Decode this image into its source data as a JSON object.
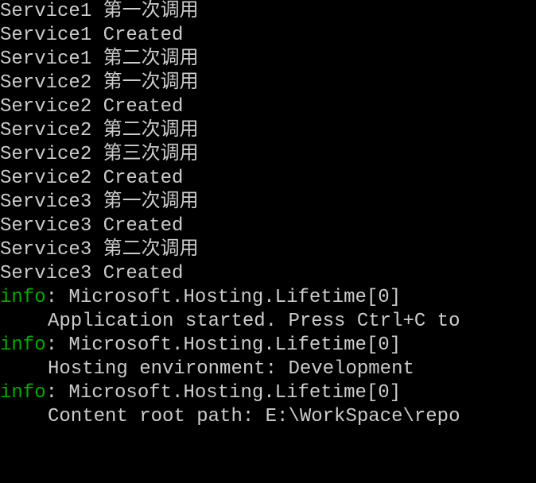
{
  "lines": [
    {
      "text": "Service1 第一次调用"
    },
    {
      "text": "Service1 Created"
    },
    {
      "text": "Service1 第二次调用"
    },
    {
      "text": "Service2 第一次调用"
    },
    {
      "text": "Service2 Created"
    },
    {
      "text": "Service2 第二次调用"
    },
    {
      "text": "Service2 第三次调用"
    },
    {
      "text": "Service2 Created"
    },
    {
      "text": "Service3 第一次调用"
    },
    {
      "text": "Service3 Created"
    },
    {
      "text": "Service3 第二次调用"
    },
    {
      "text": "Service3 Created"
    }
  ],
  "info_label": "info",
  "info_colon": ": ",
  "info1_source": "Microsoft.Hosting.Lifetime[0]",
  "info1_message": "Application started. Press Ctrl+C to",
  "info2_source": "Microsoft.Hosting.Lifetime[0]",
  "info2_message": "Hosting environment: Development",
  "info3_source": "Microsoft.Hosting.Lifetime[0]",
  "info3_message": "Content root path: E:\\WorkSpace\\repo"
}
